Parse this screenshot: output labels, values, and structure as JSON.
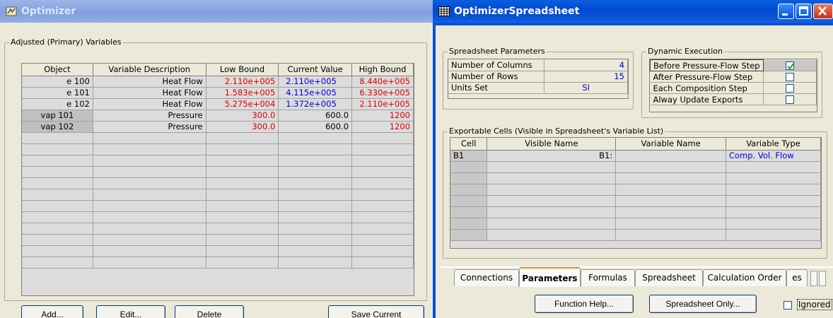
{
  "optimizer": {
    "title": "Optimizer",
    "group_label": "Adjusted (Primary) Variables",
    "columns": [
      "Object",
      "Variable Description",
      "Low Bound",
      "Current Value",
      "High Bound"
    ],
    "rows": [
      {
        "object": "e 100",
        "description": "Heat Flow",
        "low": "2.110e+005",
        "current": "2.110e+005",
        "high": "8.440e+005"
      },
      {
        "object": "e 101",
        "description": "Heat Flow",
        "low": "1.583e+005",
        "current": "4.115e+005",
        "high": "6.330e+005"
      },
      {
        "object": "e 102",
        "description": "Heat Flow",
        "low": "5.275e+004",
        "current": "1.372e+005",
        "high": "2.110e+005"
      },
      {
        "object": "vap 101",
        "description": "Pressure",
        "low": "300.0",
        "current": "600.0",
        "high": "1200"
      },
      {
        "object": "vap 102",
        "description": "Pressure",
        "low": "300.0",
        "current": "600.0",
        "high": "1200"
      }
    ],
    "buttons": {
      "add": "Add...",
      "edit": "Edit...",
      "delete": "Delete",
      "save_current": "Save Current"
    }
  },
  "spreadsheet": {
    "title": "OptimizerSpreadsheet",
    "params_label": "Spreadsheet Parameters",
    "params": [
      {
        "label": "Number of Columns",
        "value": "4"
      },
      {
        "label": "Number of Rows",
        "value": "15"
      },
      {
        "label": "Units Set",
        "value": "SI"
      }
    ],
    "dynamic_label": "Dynamic Execution",
    "dynamic": [
      {
        "label": "Before Pressure-Flow Step",
        "checked": true
      },
      {
        "label": "After Pressure-Flow Step",
        "checked": false
      },
      {
        "label": "Each Composition Step",
        "checked": false
      },
      {
        "label": "Alway Update Exports",
        "checked": false
      }
    ],
    "export_label": "Exportable Cells (Visible in Spreadsheet's Variable List)",
    "export_columns": [
      "Cell",
      "Visible Name",
      "Variable Name",
      "Variable Type"
    ],
    "export_rows": [
      {
        "cell": "B1",
        "visible": "B1:",
        "variable": "",
        "type": "Comp. Vol. Flow"
      }
    ],
    "tabs": [
      "Connections",
      "Parameters",
      "Formulas",
      "Spreadsheet",
      "Calculation Order",
      "es"
    ],
    "active_tab": "Parameters",
    "buttons": {
      "function_help": "Function Help...",
      "spreadsheet_only": "Spreadsheet Only..."
    },
    "ignored_label": "Ignored"
  },
  "colors": {
    "active_title": "#0148d0",
    "red_value": "#e00000",
    "blue_value": "#0000e0"
  }
}
